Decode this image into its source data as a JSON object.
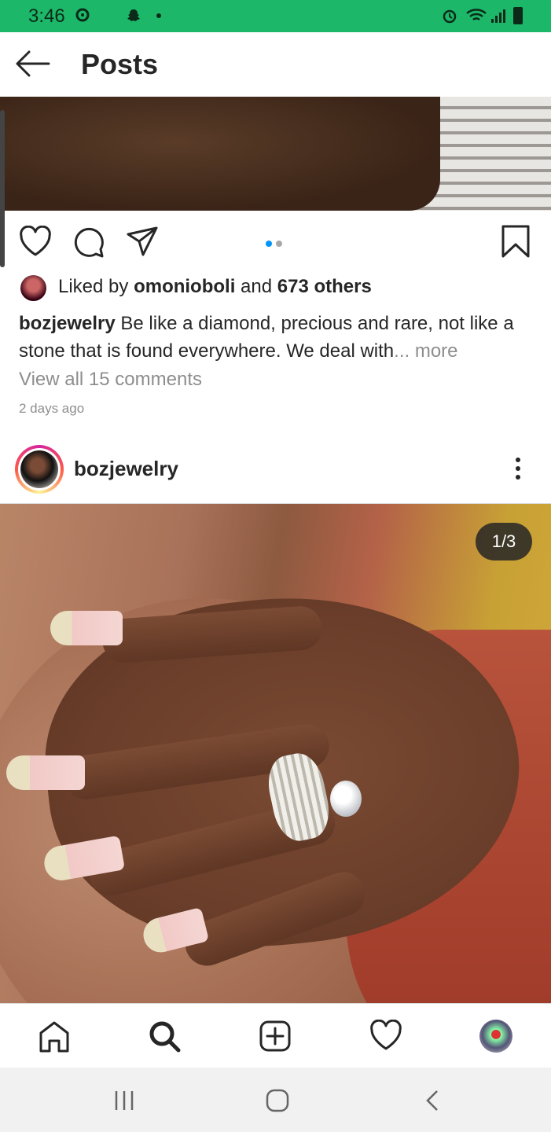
{
  "status_bar": {
    "time": "3:46"
  },
  "header": {
    "title": "Posts"
  },
  "post1": {
    "carousel_pages": 2,
    "carousel_active": 1,
    "likes_prefix": "Liked by ",
    "liked_by_user": "omonioboli",
    "likes_mid": " and ",
    "likes_others": "673 others",
    "caption_user": "bozjewelry",
    "caption_text": " Be like a diamond, precious and rare, not like a stone that is found everywhere. We deal with",
    "caption_ellipsis": "... ",
    "caption_more": "more",
    "view_comments": "View all 15 comments",
    "age": "2 days ago"
  },
  "post2": {
    "username": "bozjewelry",
    "counter": "1/3"
  },
  "colors": {
    "status_green": "#1db76a",
    "accent_blue": "#0095f6",
    "muted": "#8e8e8e"
  },
  "icons": [
    "heart-icon",
    "comment-icon",
    "share-icon",
    "bookmark-icon",
    "back-arrow-icon",
    "home-icon",
    "search-icon",
    "add-icon",
    "activity-heart-icon",
    "more-vertical-icon"
  ]
}
